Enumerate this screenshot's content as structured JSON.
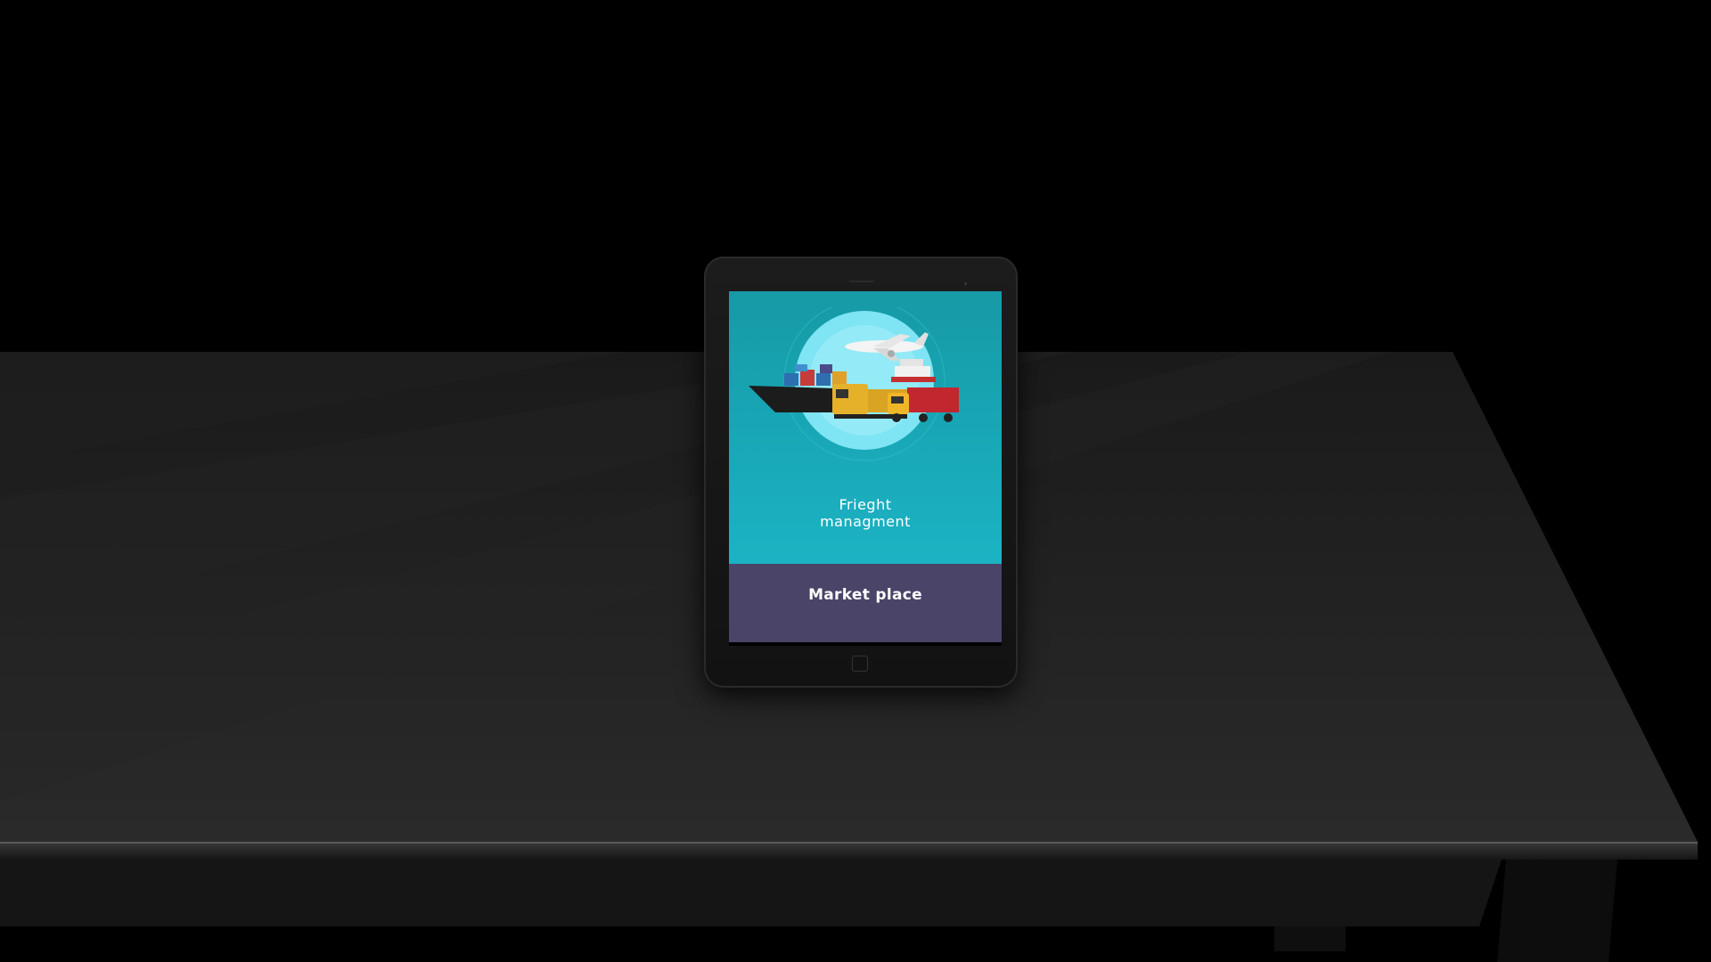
{
  "app": {
    "panels": [
      {
        "label": "Frieght\nmanagment",
        "icon": "freight-transport-illustration"
      },
      {
        "label": "Market place"
      }
    ]
  },
  "colors": {
    "background": "#000000",
    "freight_panel": "#1bb3c4",
    "market_panel": "#4a4468",
    "text": "#ffffff"
  }
}
